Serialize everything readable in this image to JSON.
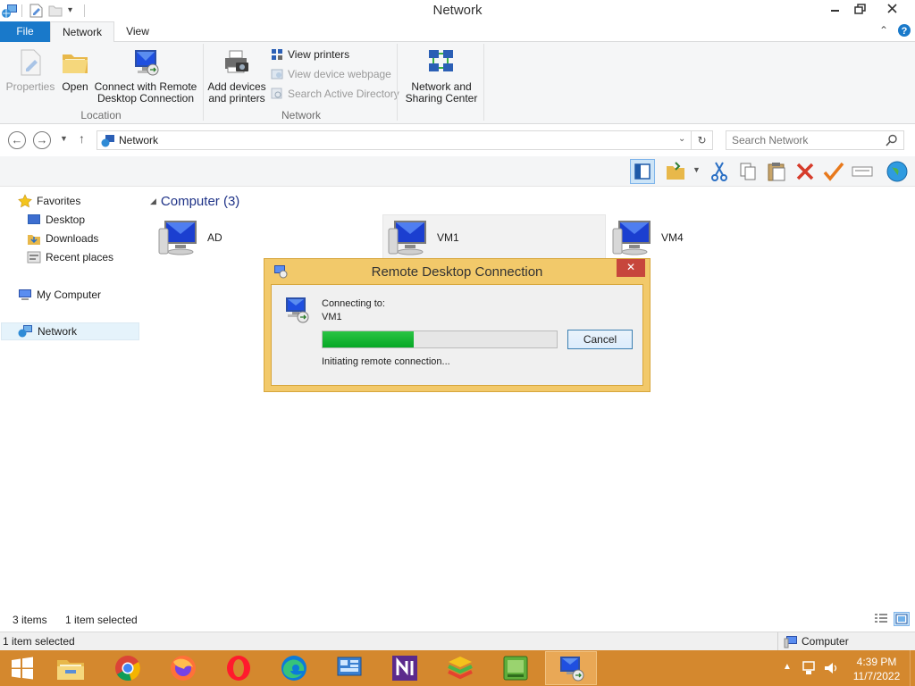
{
  "window": {
    "title": "Network"
  },
  "tabs": {
    "file": "File",
    "network": "Network",
    "view": "View"
  },
  "ribbon": {
    "properties": "Properties",
    "open": "Open",
    "connect_line1": "Connect with Remote",
    "connect_line2": "Desktop Connection",
    "location_group": "Location",
    "add_devices_line1": "Add devices",
    "add_devices_line2": "and printers",
    "view_printers": "View printers",
    "view_device_webpage": "View device webpage",
    "search_ad": "Search Active Directory",
    "network_group": "Network",
    "nsc_line1": "Network and",
    "nsc_line2": "Sharing Center"
  },
  "address": {
    "path": "Network",
    "search_placeholder": "Search Network"
  },
  "nav": {
    "favorites": "Favorites",
    "desktop": "Desktop",
    "downloads": "Downloads",
    "recent": "Recent places",
    "mycomputer": "My Computer",
    "network": "Network"
  },
  "content": {
    "group_header": "Computer (3)",
    "computers": [
      "AD",
      "VM1",
      "VM4"
    ]
  },
  "dialog": {
    "title": "Remote Desktop Connection",
    "close": "✕",
    "connecting_label": "Connecting to:",
    "target": "VM1",
    "progress": 0.39,
    "cancel": "Cancel",
    "status": "Initiating remote connection..."
  },
  "status": {
    "items": "3 items",
    "selected": "1 item selected"
  },
  "infobar": {
    "left": "1 item selected",
    "right": "Computer"
  },
  "taskbar": {
    "time": "4:39 PM",
    "date": "11/7/2022"
  }
}
